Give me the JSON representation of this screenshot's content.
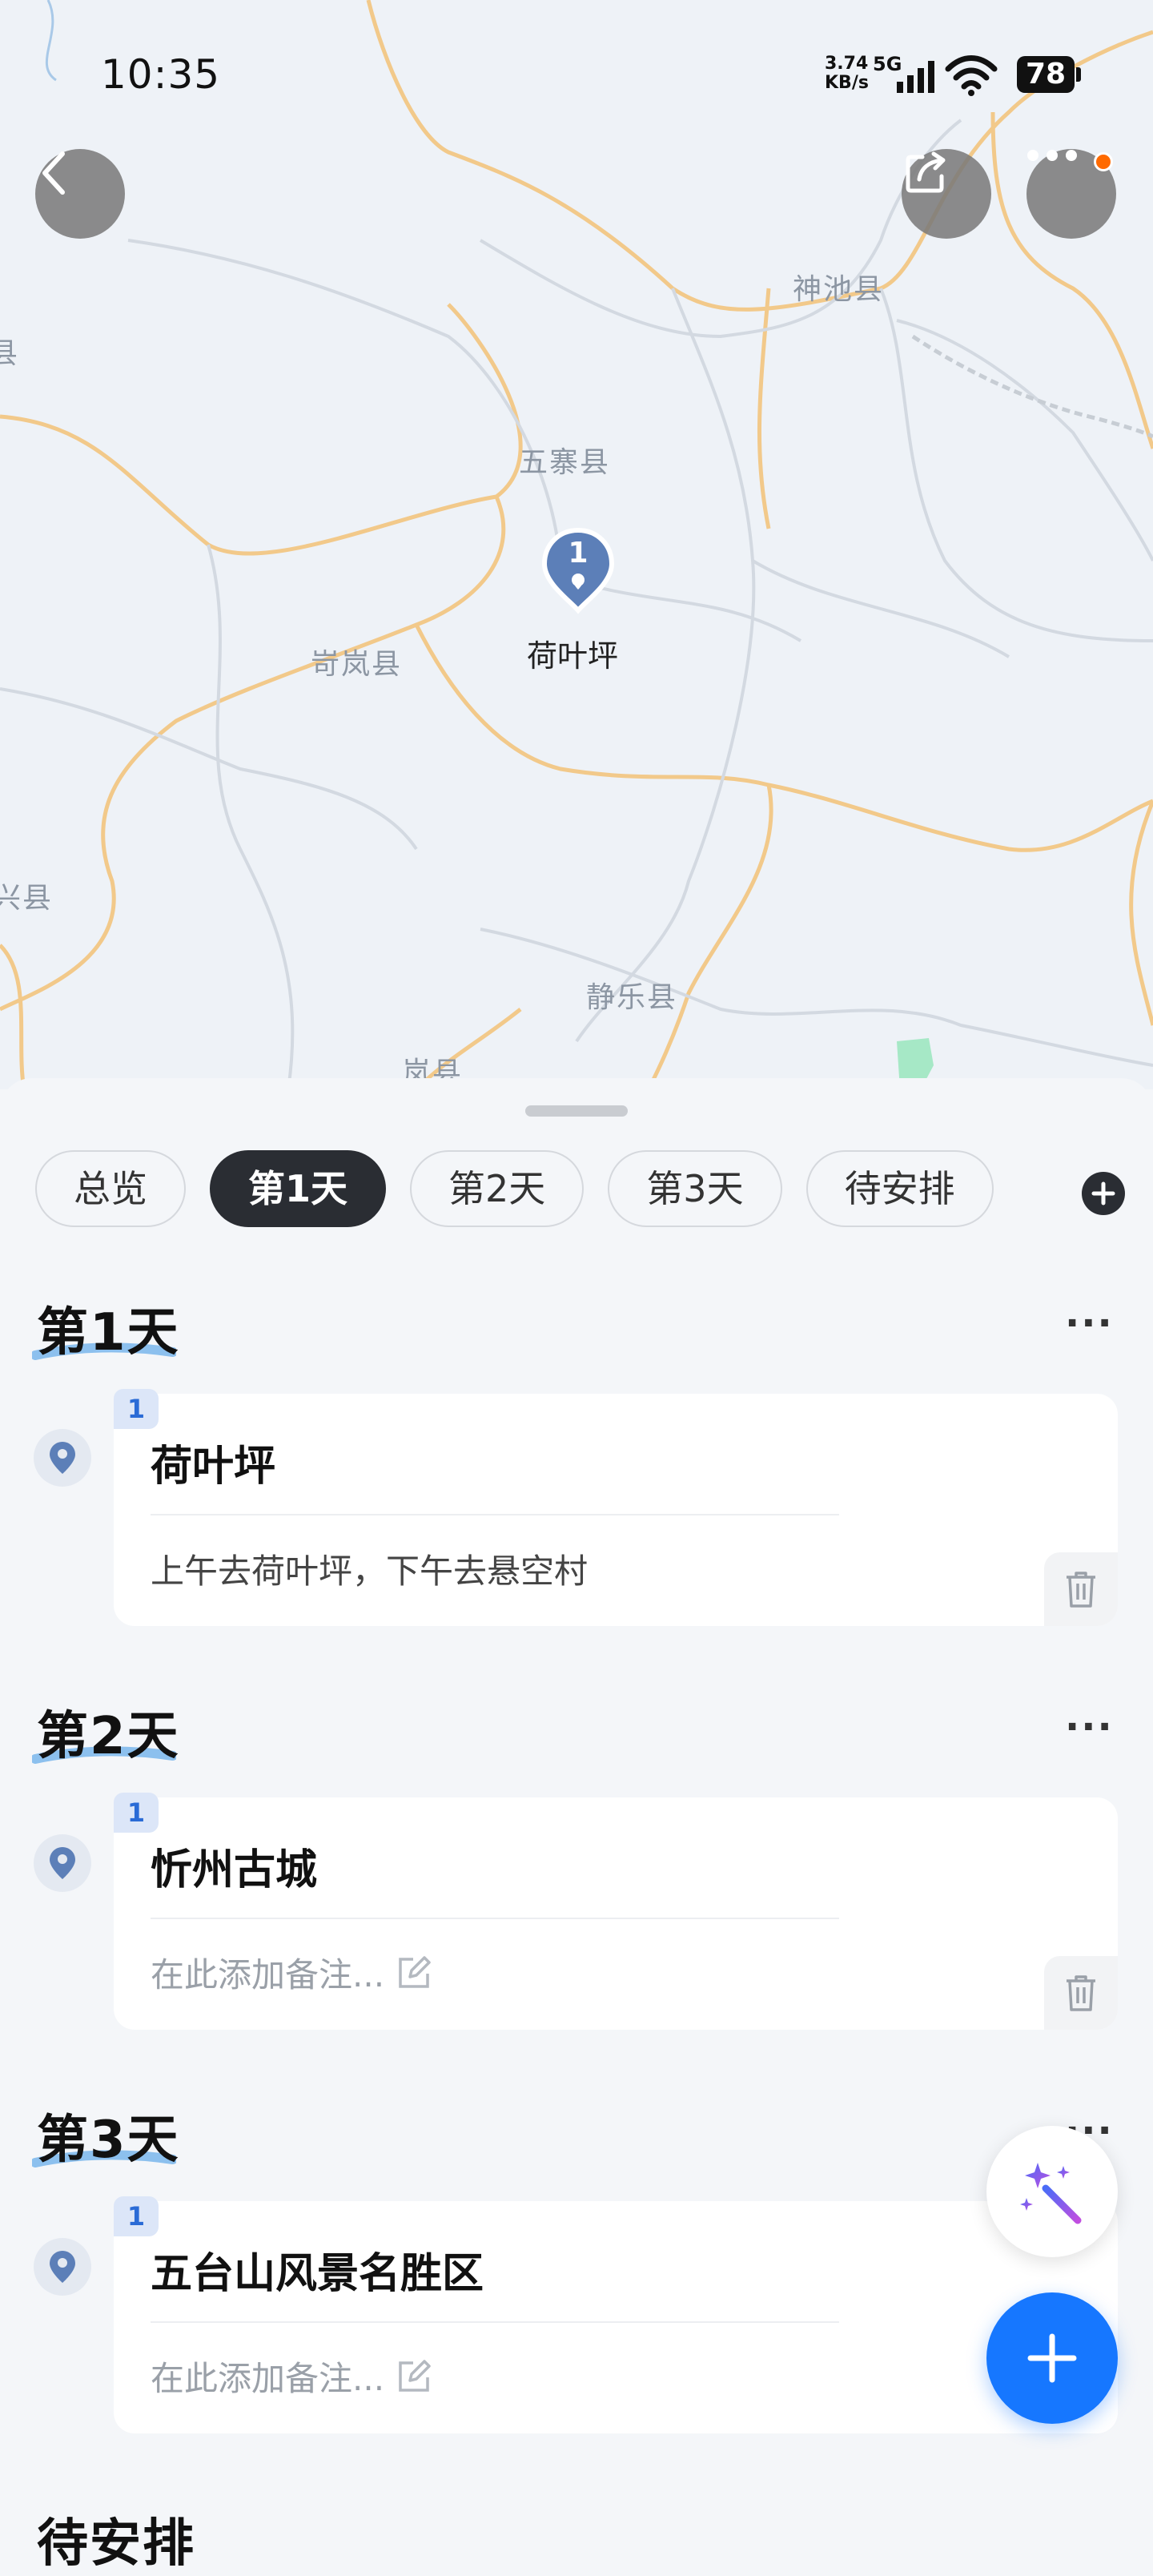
{
  "status_bar": {
    "time": "10:35",
    "net_speed_value": "3.74",
    "net_speed_unit": "KB/s",
    "network": "5G",
    "battery": "78"
  },
  "map": {
    "labels": {
      "shenchi": "神池县",
      "wuzhai": "五寨县",
      "kelan": "岢岚县",
      "jingle": "静乐县",
      "xing": "兴县",
      "lan": "岚县",
      "left_edge": "县"
    },
    "poi": {
      "index": "1",
      "name": "荷叶坪"
    }
  },
  "tabs": [
    "总览",
    "第1天",
    "第2天",
    "第3天",
    "待安排"
  ],
  "days": [
    {
      "title": "第1天",
      "more": "···",
      "stop_index": "1",
      "stop_name": "荷叶坪",
      "note": "上午去荷叶坪，下午去悬空村"
    },
    {
      "title": "第2天",
      "more": "···",
      "stop_index": "1",
      "stop_name": "忻州古城",
      "note": "在此添加备注..."
    },
    {
      "title": "第3天",
      "more": "···",
      "stop_index": "1",
      "stop_name": "五台山风景名胜区",
      "note": "在此添加备注..."
    }
  ],
  "pending": {
    "title": "待安排"
  },
  "colors": {
    "accent": "#1677ff",
    "active_chip": "#2a2d33",
    "day_underline": "#7fb6ea",
    "pin": "#5c7fb8"
  },
  "icons": [
    "back-arrow-icon",
    "share-icon",
    "more-dots-icon",
    "location-pin-icon",
    "trash-icon",
    "edit-icon",
    "magic-wand-icon",
    "plus-icon"
  ]
}
